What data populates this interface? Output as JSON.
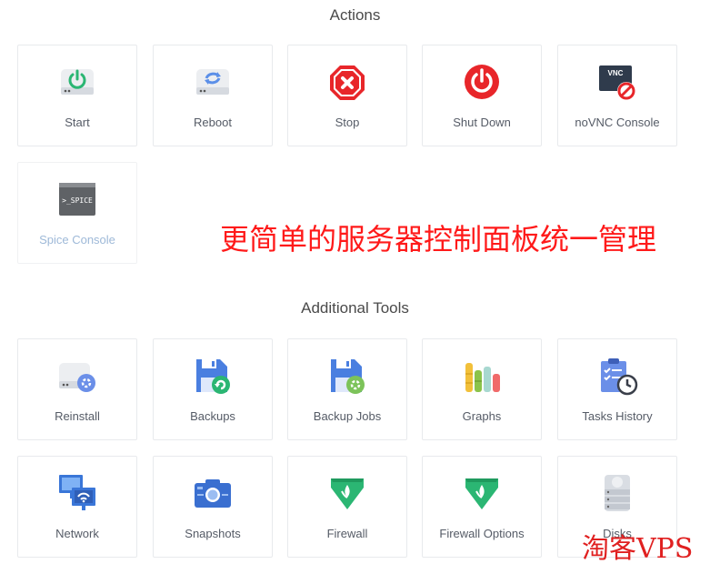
{
  "sections": {
    "actions_title": "Actions",
    "tools_title": "Additional Tools"
  },
  "actions": [
    {
      "label": "Start",
      "icon": "start-server-icon"
    },
    {
      "label": "Reboot",
      "icon": "reboot-server-icon"
    },
    {
      "label": "Stop",
      "icon": "stop-icon"
    },
    {
      "label": "Shut Down",
      "icon": "power-icon"
    },
    {
      "label": "noVNC Console",
      "icon": "vnc-console-icon",
      "icon_text": "VNC"
    },
    {
      "label": "Spice Console",
      "icon": "spice-console-icon",
      "icon_text": ">_SPICE",
      "state": "disabled"
    }
  ],
  "tools": [
    {
      "label": "Reinstall",
      "icon": "reinstall-icon"
    },
    {
      "label": "Backups",
      "icon": "backups-icon"
    },
    {
      "label": "Backup Jobs",
      "icon": "backup-jobs-icon"
    },
    {
      "label": "Graphs",
      "icon": "graphs-icon"
    },
    {
      "label": "Tasks History",
      "icon": "tasks-history-icon"
    },
    {
      "label": "Network",
      "icon": "network-icon"
    },
    {
      "label": "Snapshots",
      "icon": "snapshots-icon"
    },
    {
      "label": "Firewall",
      "icon": "firewall-icon"
    },
    {
      "label": "Firewall Options",
      "icon": "firewall-options-icon"
    },
    {
      "label": "Disks",
      "icon": "disks-icon"
    }
  ],
  "overlay": {
    "promo_text": "更简单的服务器控制面板统一管理",
    "watermark_text": "淘客VPS"
  },
  "colors": {
    "accent_blue": "#4a7fe0",
    "red": "#e8262a",
    "green": "#2bb673",
    "promo_red": "#ff1a1a"
  }
}
